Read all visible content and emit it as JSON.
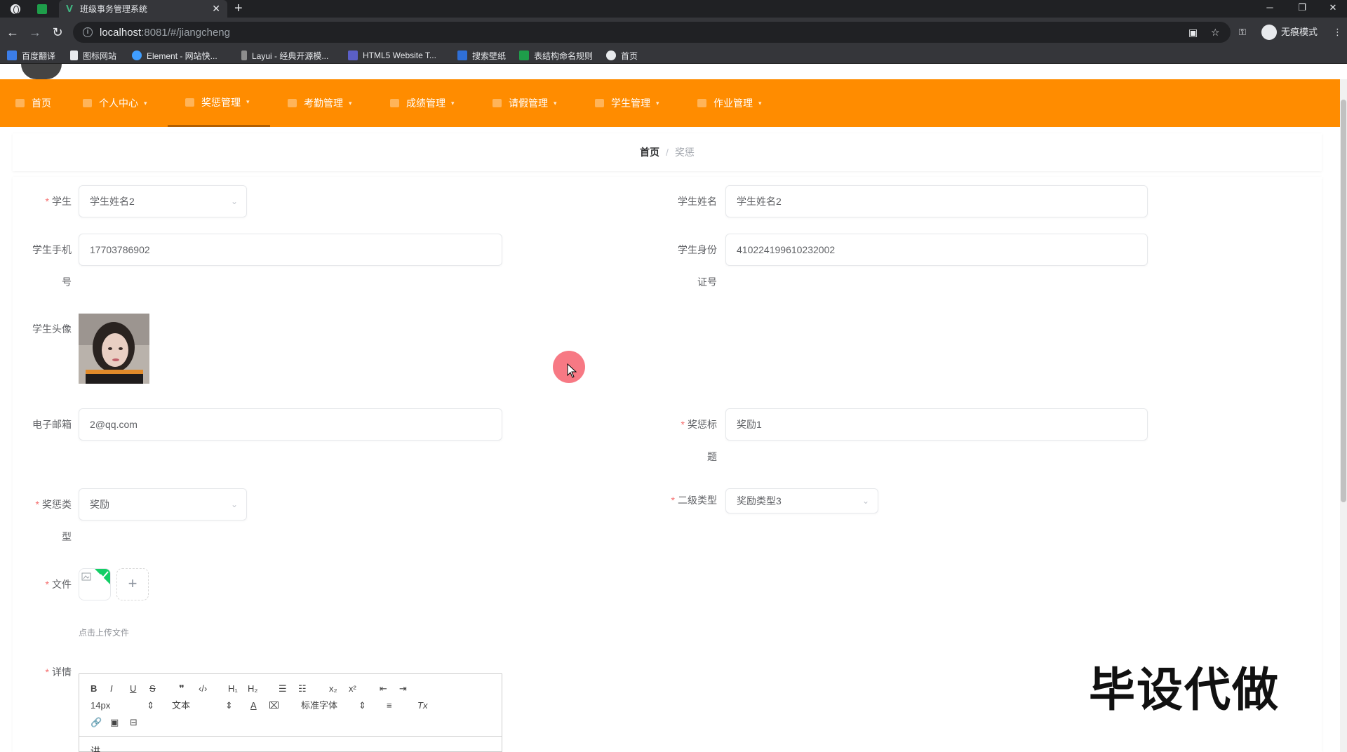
{
  "browser": {
    "tab_title": "班级事务管理系统",
    "url_host": "localhost",
    "url_path": ":8081/#/jiangcheng",
    "profile_label": "无痕模式",
    "bookmarks": [
      "百度翻译",
      "图标网站",
      "Element - 网站快...",
      "Layui - 经典开源模...",
      "HTML5 Website T...",
      "搜索壁纸",
      "表结构命名规则",
      "首页"
    ]
  },
  "nav": {
    "items": [
      "首页",
      "个人中心",
      "奖惩管理",
      "考勤管理",
      "成绩管理",
      "请假管理",
      "学生管理",
      "作业管理"
    ],
    "active_index": 2,
    "bar_color": "#ff8c00"
  },
  "breadcrumb": {
    "home": "首页",
    "separator": "/",
    "current": "奖惩"
  },
  "form": {
    "student_label": "学生",
    "student_value": "学生姓名2",
    "student_name_label": "学生姓名",
    "student_name_value": "学生姓名2",
    "phone_label_1": "学生手机",
    "phone_label_2": "号",
    "phone_value": "17703786902",
    "idcard_label_1": "学生身份",
    "idcard_label_2": "证号",
    "idcard_value": "410224199610232002",
    "avatar_label": "学生头像",
    "email_label": "电子邮箱",
    "email_value": "2@qq.com",
    "title_label_1": "奖惩标",
    "title_label_2": "题",
    "title_value": "奖励1",
    "type_label_1": "奖惩类",
    "type_label_2": "型",
    "type_value": "奖励",
    "subtype_label": "二级类型",
    "subtype_value": "奖励类型3",
    "file_label": "文件",
    "file_tip": "点击上传文件",
    "detail_label": "详情",
    "required_mark": "*"
  },
  "editor": {
    "font_size": "14px",
    "header_select": "文本",
    "font_family": "标准字体",
    "body_text": "讲"
  },
  "watermark": "毕设代做"
}
